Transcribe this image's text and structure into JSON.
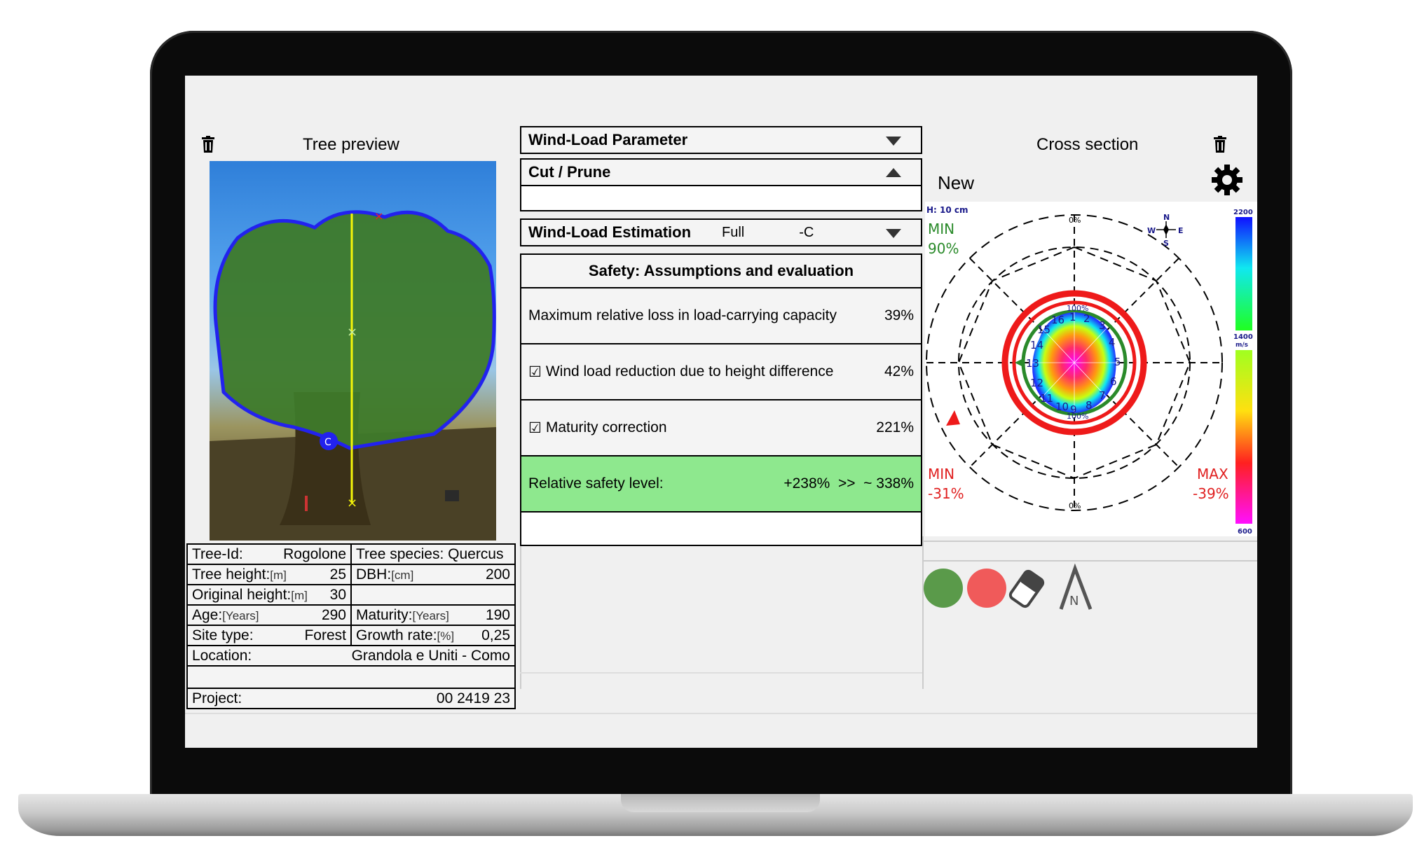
{
  "left": {
    "title": "Tree preview",
    "info": {
      "tree_id_label": "Tree-Id:",
      "tree_id": "Rogolone",
      "species_label": "Tree species:",
      "species": "Quercus",
      "height_label": "Tree height:",
      "height_unit": "[m]",
      "height": "25",
      "dbh_label": "DBH:",
      "dbh_unit": "[cm]",
      "dbh": "200",
      "orig_label": "Original height:",
      "orig_unit": "[m]",
      "orig": "30",
      "age_label": "Age:",
      "age_unit": "[Years]",
      "age": "290",
      "maturity_label": "Maturity:",
      "maturity_unit": "[Years]",
      "maturity": "190",
      "site_label": "Site type:",
      "site": "Forest",
      "growth_label": "Growth rate:",
      "growth_unit": "[%]",
      "growth": "0,25",
      "location_label": "Location:",
      "location": "Grandola e Uniti - Como",
      "project_label": "Project:",
      "project": "00 2419 23"
    }
  },
  "middle": {
    "wind_param": "Wind-Load Parameter",
    "cut_prune": "Cut / Prune",
    "wind_est": "Wind-Load Estimation",
    "wind_est_mode": "Full",
    "wind_est_opt": "-C",
    "safety_title": "Safety: Assumptions and evaluation",
    "rows": [
      {
        "label": "Maximum relative loss in load-carrying capacity",
        "value": "39%"
      },
      {
        "label": "Wind load reduction due to height difference",
        "value": "42%"
      },
      {
        "label": "Maturity correction",
        "value": "221%"
      }
    ],
    "relative": {
      "label": "Relative safety level:",
      "value": "+238%  >>  ~ 338%"
    }
  },
  "right": {
    "title": "Cross section",
    "new_label": "New",
    "height": "H: 10 cm",
    "min_green_label": "MIN",
    "min_green_val": "90%",
    "min_red_label": "MIN",
    "min_red_val": "-31%",
    "max_red_label": "MAX",
    "max_red_val": "-39%",
    "scale_top": "2200",
    "scale_mid": "1400",
    "scale_unit": "m/s",
    "scale_bottom": "600",
    "compass": {
      "n": "N",
      "s": "S",
      "e": "E",
      "w": "W"
    },
    "pct_top": "0%",
    "pct_bottom": "0%",
    "pct_inner_top": "100%",
    "pct_inner_bottom": "100%",
    "sensor_numbers": [
      "1",
      "2",
      "3",
      "4",
      "5",
      "6",
      "7",
      "8",
      "9",
      "10",
      "11",
      "12",
      "13",
      "14",
      "15",
      "16"
    ],
    "north_label": "N",
    "colors": {
      "green": "#5a9a4a",
      "red": "#f05a5a"
    }
  }
}
